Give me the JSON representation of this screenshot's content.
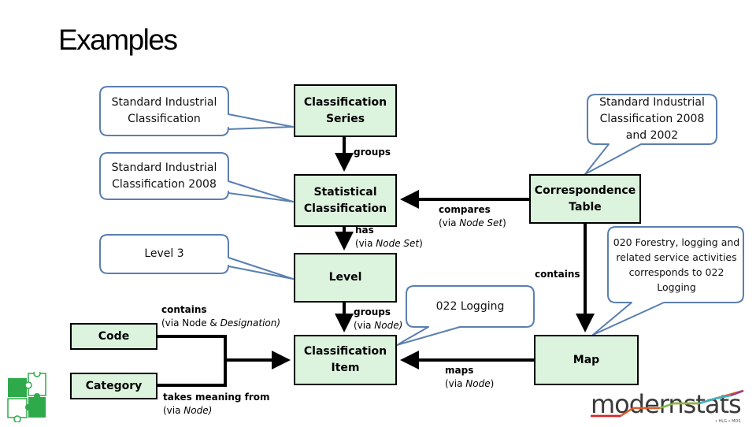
{
  "slide": {
    "title": "Examples"
  },
  "boxes": {
    "classification_series": "Classification Series",
    "statistical_classification": "Statistical Classification",
    "correspondence_table": "Correspondence Table",
    "level": "Level",
    "classification_item": "Classification Item",
    "map": "Map",
    "code": "Code",
    "category": "Category"
  },
  "callouts": {
    "sic": "Standard Industrial Classification",
    "sic_2008": "Standard Industrial Classification 2008",
    "level_3": "Level 3",
    "sic_2008_2002": "Standard Industrial Classification 2008 and 2002",
    "forestry": "020 Forestry, logging and related service activities corresponds to 022 Logging",
    "logging": "022 Logging"
  },
  "relations": {
    "groups": {
      "verb": "groups"
    },
    "has": {
      "verb": "has",
      "via_prefix": "(via ",
      "via_term": "Node Set",
      "via_suffix": ")"
    },
    "compares": {
      "verb": "compares",
      "via_prefix": "(via ",
      "via_term": "Node Set",
      "via_suffix": ")"
    },
    "contains_map": {
      "verb": "contains"
    },
    "groups_node": {
      "verb": "groups",
      "via_prefix": "(via ",
      "via_term": "Node)",
      "via_suffix": ""
    },
    "maps": {
      "verb": "maps",
      "via_prefix": "(via ",
      "via_term": "Node",
      "via_suffix": ")"
    },
    "contains_code": {
      "verb": "contains",
      "via_prefix": "(via Node & ",
      "via_term": "Designation)",
      "via_suffix": ""
    },
    "takes_meaning": {
      "verb": "takes meaning from",
      "via_prefix": "(via ",
      "via_term": "Node)",
      "via_suffix": ""
    }
  },
  "logo": {
    "name": "modernstats",
    "subtitle": "• HLG • MOS"
  },
  "colors": {
    "box_fill": "#dcf3de",
    "callout_stroke": "#5a7fb0",
    "puzzle_green": "#2eaa4a"
  }
}
